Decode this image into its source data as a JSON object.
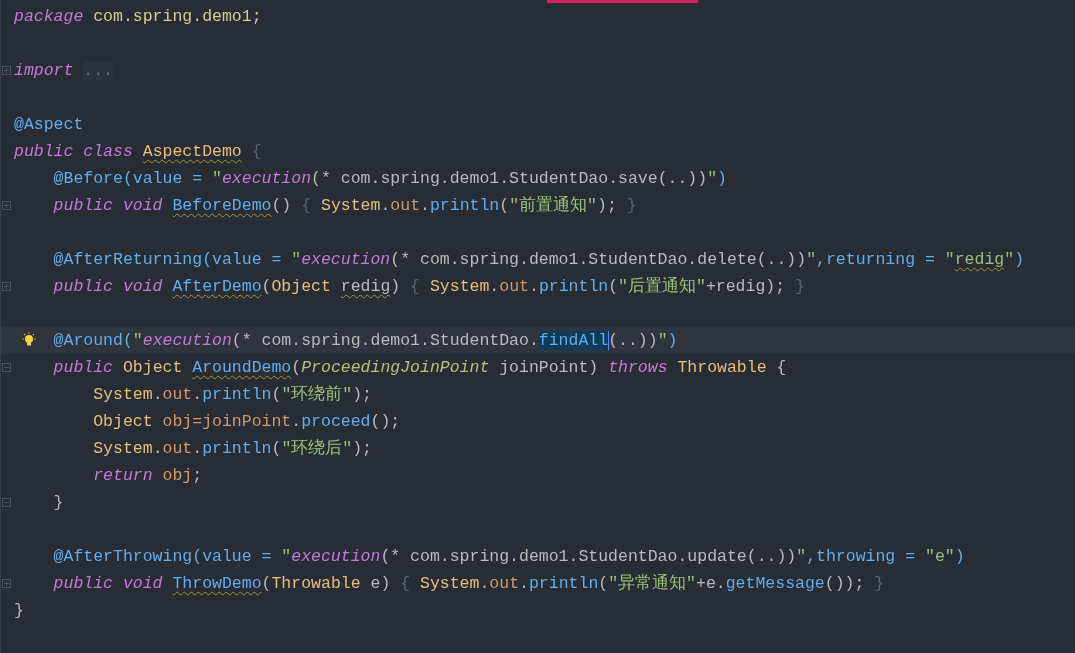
{
  "editor": {
    "lines": [
      {
        "tokens": [
          {
            "kind": "kw",
            "text": "package"
          },
          {
            "kind": "pkg",
            "text": " com.spring.demo1;"
          }
        ]
      },
      {
        "gap_before": true,
        "expanded": false,
        "tokens": [
          {
            "kind": "kw",
            "text": "import "
          },
          {
            "kind": "folded",
            "text": "..."
          }
        ]
      },
      {
        "gap_before": true,
        "tokens": [
          {
            "kind": "ann",
            "text": "@Aspect"
          }
        ]
      },
      {
        "tokens": [
          {
            "kind": "kw",
            "text": "public class "
          },
          {
            "kind": "cls-warn",
            "text": "AspectDemo"
          },
          {
            "kind": "dim",
            "text": " {"
          }
        ]
      },
      {
        "tokens": [
          {
            "kind": "ann",
            "text": "    @Before(value = "
          },
          {
            "kind": "str",
            "text": "\""
          },
          {
            "kind": "exe",
            "text": "execution"
          },
          {
            "kind": "plain",
            "text": "(* com.spring.demo1.StudentDao.save(..))"
          },
          {
            "kind": "str",
            "text": "\""
          },
          {
            "kind": "ann",
            "text": ")"
          }
        ]
      },
      {
        "expanded": false,
        "tokens": [
          {
            "kind": "kw",
            "text": "    public void "
          },
          {
            "kind": "decl-warn",
            "text": "BeforeDemo"
          },
          {
            "kind": "plain",
            "text": "() "
          },
          {
            "kind": "dim",
            "text": "{ "
          },
          {
            "kind": "type",
            "text": "System"
          },
          {
            "kind": "plain",
            "text": "."
          },
          {
            "kind": "field",
            "text": "out"
          },
          {
            "kind": "plain",
            "text": "."
          },
          {
            "kind": "call",
            "text": "println"
          },
          {
            "kind": "plain",
            "text": "("
          },
          {
            "kind": "str",
            "text": "\"前置通知\""
          },
          {
            "kind": "plain",
            "text": "); "
          },
          {
            "kind": "dim",
            "text": "}"
          }
        ]
      },
      {
        "gap_before": true,
        "tokens": [
          {
            "kind": "ann",
            "text": "    @AfterReturning(value = "
          },
          {
            "kind": "str",
            "text": "\""
          },
          {
            "kind": "exe",
            "text": "execution"
          },
          {
            "kind": "plain",
            "text": "(* com.spring.demo1.StudentDao.delete(..))"
          },
          {
            "kind": "str",
            "text": "\""
          },
          {
            "kind": "ann",
            "text": ",returning = "
          },
          {
            "kind": "str",
            "text": "\""
          },
          {
            "kind": "str-warn",
            "text": "redig"
          },
          {
            "kind": "str",
            "text": "\""
          },
          {
            "kind": "ann",
            "text": ")"
          }
        ]
      },
      {
        "expanded": false,
        "tokens": [
          {
            "kind": "kw",
            "text": "    public void "
          },
          {
            "kind": "decl-warn",
            "text": "AfterDemo"
          },
          {
            "kind": "plain",
            "text": "("
          },
          {
            "kind": "type",
            "text": "Object "
          },
          {
            "kind": "plain-warn",
            "text": "redig"
          },
          {
            "kind": "plain",
            "text": ") "
          },
          {
            "kind": "dim",
            "text": "{ "
          },
          {
            "kind": "type",
            "text": "System"
          },
          {
            "kind": "plain",
            "text": "."
          },
          {
            "kind": "field",
            "text": "out"
          },
          {
            "kind": "plain",
            "text": "."
          },
          {
            "kind": "call",
            "text": "println"
          },
          {
            "kind": "plain",
            "text": "("
          },
          {
            "kind": "str",
            "text": "\"后置通知\""
          },
          {
            "kind": "plain",
            "text": "+redig); "
          },
          {
            "kind": "dim",
            "text": "}"
          }
        ]
      },
      {
        "gap_before": true,
        "current": true,
        "hint_bulb": true,
        "tokens": [
          {
            "kind": "ann",
            "text": "    @Around("
          },
          {
            "kind": "str",
            "text": "\""
          },
          {
            "kind": "exe",
            "text": "execution"
          },
          {
            "kind": "plain",
            "text": "(* com.spring.demo1.StudentDao."
          },
          {
            "kind": "sel",
            "text": "findAll"
          },
          {
            "kind": "plain",
            "text": "(..))"
          },
          {
            "kind": "str",
            "text": "\""
          },
          {
            "kind": "ann",
            "text": ")"
          }
        ]
      },
      {
        "expanded": true,
        "tokens": [
          {
            "kind": "kw",
            "text": "    public "
          },
          {
            "kind": "type",
            "text": "Object "
          },
          {
            "kind": "decl-warn",
            "text": "AroundDemo"
          },
          {
            "kind": "plain",
            "text": "("
          },
          {
            "kind": "ptype",
            "text": "ProceedingJoinPoint"
          },
          {
            "kind": "plain",
            "text": " joinPoint) "
          },
          {
            "kind": "kw",
            "text": "throws "
          },
          {
            "kind": "type",
            "text": "Throwable "
          },
          {
            "kind": "plain",
            "text": "{"
          }
        ]
      },
      {
        "tokens": [
          {
            "kind": "type",
            "text": "        System"
          },
          {
            "kind": "plain",
            "text": "."
          },
          {
            "kind": "field",
            "text": "out"
          },
          {
            "kind": "plain",
            "text": "."
          },
          {
            "kind": "call",
            "text": "println"
          },
          {
            "kind": "plain",
            "text": "("
          },
          {
            "kind": "str",
            "text": "\"环绕前\""
          },
          {
            "kind": "plain",
            "text": ");"
          }
        ]
      },
      {
        "tokens": [
          {
            "kind": "type",
            "text": "        Object "
          },
          {
            "kind": "field",
            "text": "obj=joinPoint"
          },
          {
            "kind": "plain",
            "text": "."
          },
          {
            "kind": "call",
            "text": "proceed"
          },
          {
            "kind": "plain",
            "text": "();"
          }
        ]
      },
      {
        "tokens": [
          {
            "kind": "type",
            "text": "        System"
          },
          {
            "kind": "plain",
            "text": "."
          },
          {
            "kind": "field",
            "text": "out"
          },
          {
            "kind": "plain",
            "text": "."
          },
          {
            "kind": "call",
            "text": "println"
          },
          {
            "kind": "plain",
            "text": "("
          },
          {
            "kind": "str",
            "text": "\"环绕后\""
          },
          {
            "kind": "plain",
            "text": ");"
          }
        ]
      },
      {
        "tokens": [
          {
            "kind": "kw",
            "text": "        return "
          },
          {
            "kind": "field",
            "text": "obj"
          },
          {
            "kind": "plain",
            "text": ";"
          }
        ]
      },
      {
        "expanded": true,
        "tokens": [
          {
            "kind": "plain",
            "text": "    }"
          }
        ]
      },
      {
        "gap_before": true,
        "tokens": [
          {
            "kind": "ann",
            "text": "    @AfterThrowing(value = "
          },
          {
            "kind": "str",
            "text": "\""
          },
          {
            "kind": "exe",
            "text": "execution"
          },
          {
            "kind": "plain",
            "text": "(* com.spring.demo1.StudentDao.update(..))"
          },
          {
            "kind": "str",
            "text": "\""
          },
          {
            "kind": "ann",
            "text": ",throwing = "
          },
          {
            "kind": "str",
            "text": "\"e\""
          },
          {
            "kind": "ann",
            "text": ")"
          }
        ]
      },
      {
        "expanded": false,
        "tokens": [
          {
            "kind": "kw",
            "text": "    public void "
          },
          {
            "kind": "decl-warn",
            "text": "ThrowDemo"
          },
          {
            "kind": "plain",
            "text": "("
          },
          {
            "kind": "type",
            "text": "Throwable"
          },
          {
            "kind": "plain",
            "text": " e) "
          },
          {
            "kind": "dim",
            "text": "{ "
          },
          {
            "kind": "type",
            "text": "System"
          },
          {
            "kind": "plain",
            "text": "."
          },
          {
            "kind": "field",
            "text": "out"
          },
          {
            "kind": "plain",
            "text": "."
          },
          {
            "kind": "call",
            "text": "println"
          },
          {
            "kind": "plain",
            "text": "("
          },
          {
            "kind": "str",
            "text": "\"异常通知\""
          },
          {
            "kind": "plain",
            "text": "+e."
          },
          {
            "kind": "call",
            "text": "getMessage"
          },
          {
            "kind": "plain",
            "text": "()); "
          },
          {
            "kind": "dim",
            "text": "}"
          }
        ]
      },
      {
        "tokens": [
          {
            "kind": "plain",
            "text": "}"
          }
        ]
      }
    ]
  }
}
